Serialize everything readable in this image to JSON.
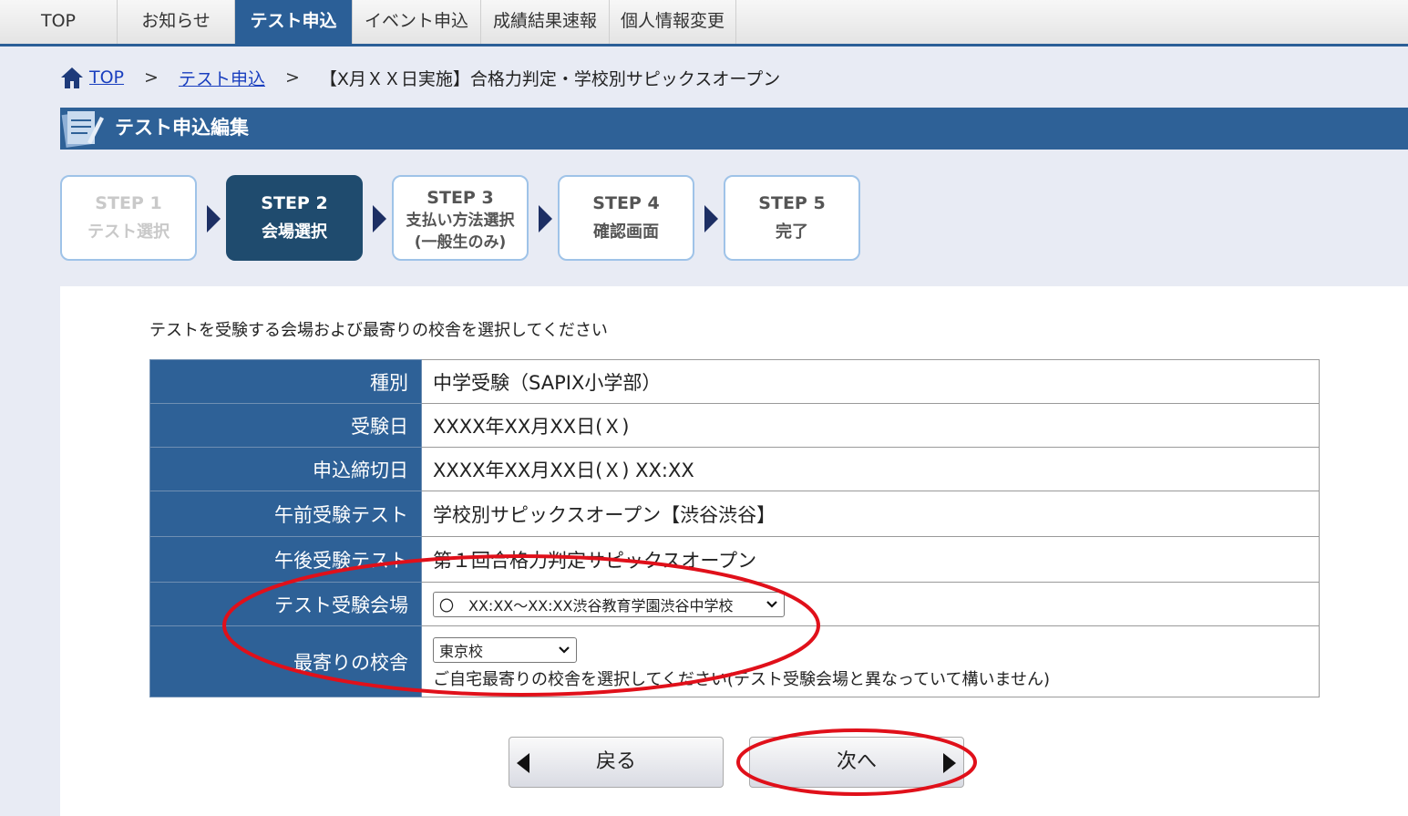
{
  "nav": {
    "tabs": [
      {
        "label": "TOP"
      },
      {
        "label": "お知らせ"
      },
      {
        "label": "テスト申込"
      },
      {
        "label": "イベント申込"
      },
      {
        "label": "成績結果速報"
      },
      {
        "label": "個人情報変更"
      }
    ],
    "active_index": 2
  },
  "breadcrumb": {
    "home": "TOP",
    "section": "テスト申込",
    "current": "【X月ＸＸ日実施】合格力判定・学校別サピックスオープン",
    "separator": ">"
  },
  "section_title": "テスト申込編集",
  "steps": [
    {
      "step": "STEP 1",
      "label": "テスト選択",
      "state": "done"
    },
    {
      "step": "STEP 2",
      "label": "会場選択",
      "state": "current"
    },
    {
      "step": "STEP 3",
      "label": "支払い方法選択",
      "sub": "(一般生のみ)",
      "state": "upcoming"
    },
    {
      "step": "STEP 4",
      "label": "確認画面",
      "state": "upcoming"
    },
    {
      "step": "STEP 5",
      "label": "完了",
      "state": "upcoming"
    }
  ],
  "intro": "テストを受験する会場および最寄りの校舎を選択してください",
  "form": {
    "rows": [
      {
        "label": "種別",
        "value": "中学受験（SAPIX小学部）"
      },
      {
        "label": "受験日",
        "value": "XXXX年XX月XX日(Ｘ)"
      },
      {
        "label": "申込締切日",
        "value": "XXXX年XX月XX日(Ｘ) XX:XX"
      },
      {
        "label": "午前受験テスト",
        "value": "学校別サピックスオープン【渋谷渋谷】"
      },
      {
        "label": "午後受験テスト",
        "value": "第１回合格力判定サピックスオープン"
      }
    ],
    "venue_label": "テスト受験会場",
    "venue_selected": "〇　XX:XX～XX:XX渋谷教育学園渋谷中学校",
    "school_label": "最寄りの校舎",
    "school_selected": "東京校",
    "school_note": "ご自宅最寄りの校舎を選択してください(テスト受験会場と異なっていて構いません)"
  },
  "buttons": {
    "back": "戻る",
    "next": "次へ"
  },
  "colors": {
    "brand": "#2e6197",
    "current_step": "#1f4b6e",
    "highlight": "#e0101a"
  }
}
